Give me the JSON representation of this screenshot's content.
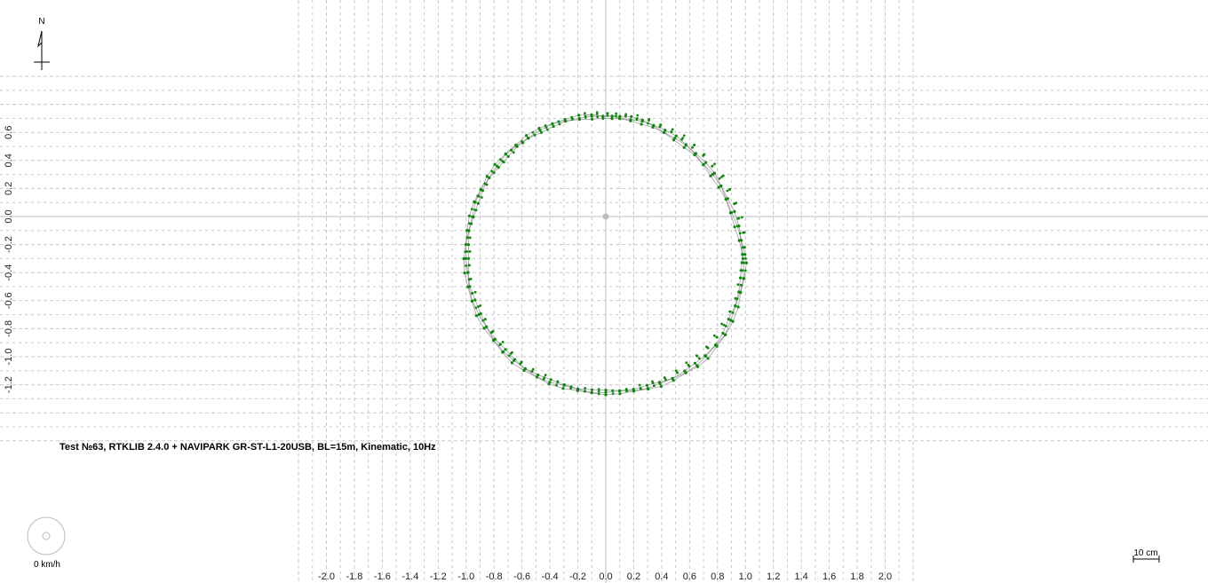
{
  "chart_data": {
    "type": "scatter",
    "title": "",
    "annotation": "Test №63, RTKLIB 2.4.0 + NAVIPARK GR-ST-L1-20USB, BL=15m, Kinematic, 10Hz",
    "xlabel": "",
    "ylabel": "",
    "xlim": [
      -2.0,
      2.0
    ],
    "ylim": [
      -1.2,
      0.6
    ],
    "x_ticks": [
      "-2.0",
      "-1.8",
      "-1.6",
      "-1.4",
      "-1.2",
      "-1.0",
      "-0.8",
      "-0.6",
      "-0.4",
      "-0.2",
      "0.0",
      "0.2",
      "0.4",
      "0.6",
      "0.8",
      "1.0",
      "1.2",
      "1.4",
      "1.6",
      "1.8",
      "2.0"
    ],
    "y_ticks": [
      "0.6",
      "0.4",
      "0.2",
      "0.0",
      "-0.2",
      "-0.4",
      "-0.6",
      "-0.8",
      "-1.0",
      "-1.2"
    ],
    "grid": true,
    "origin_marker": [
      0.0,
      0.0
    ],
    "series": [
      {
        "color": "#118811",
        "line_color": "#8f8f8f",
        "center": [
          0.0,
          -0.26
        ],
        "radius": 0.99,
        "laps": 3,
        "points": [
          [
            0.045,
            0.71
          ],
          [
            0.1,
            0.705
          ],
          [
            0.18,
            0.695
          ],
          [
            0.26,
            0.675
          ],
          [
            0.34,
            0.645
          ],
          [
            0.42,
            0.605
          ],
          [
            0.495,
            0.56
          ],
          [
            0.57,
            0.505
          ],
          [
            0.64,
            0.445
          ],
          [
            0.705,
            0.375
          ],
          [
            0.765,
            0.3
          ],
          [
            0.82,
            0.215
          ],
          [
            0.865,
            0.125
          ],
          [
            0.905,
            0.03
          ],
          [
            0.94,
            -0.07
          ],
          [
            0.965,
            -0.17
          ],
          [
            0.985,
            -0.27
          ],
          [
            0.99,
            -0.33
          ],
          [
            0.98,
            -0.44
          ],
          [
            0.96,
            -0.54
          ],
          [
            0.935,
            -0.64
          ],
          [
            0.895,
            -0.74
          ],
          [
            0.85,
            -0.84
          ],
          [
            0.79,
            -0.92
          ],
          [
            0.72,
            -1.0
          ],
          [
            0.65,
            -1.06
          ],
          [
            0.57,
            -1.11
          ],
          [
            0.48,
            -1.16
          ],
          [
            0.39,
            -1.195
          ],
          [
            0.3,
            -1.22
          ],
          [
            0.2,
            -1.24
          ],
          [
            0.1,
            -1.25
          ],
          [
            0.0,
            -1.255
          ],
          [
            -0.1,
            -1.25
          ],
          [
            -0.2,
            -1.235
          ],
          [
            -0.3,
            -1.21
          ],
          [
            -0.4,
            -1.18
          ],
          [
            -0.49,
            -1.14
          ],
          [
            -0.58,
            -1.09
          ],
          [
            -0.66,
            -1.03
          ],
          [
            -0.73,
            -0.96
          ],
          [
            -0.8,
            -0.88
          ],
          [
            -0.86,
            -0.79
          ],
          [
            -0.91,
            -0.7
          ],
          [
            -0.95,
            -0.6
          ],
          [
            -0.98,
            -0.5
          ],
          [
            -0.995,
            -0.4
          ],
          [
            -1.0,
            -0.3
          ],
          [
            -0.995,
            -0.2
          ],
          [
            -0.985,
            -0.1
          ],
          [
            -0.96,
            0.0
          ],
          [
            -0.93,
            0.1
          ],
          [
            -0.89,
            0.19
          ],
          [
            -0.84,
            0.28
          ],
          [
            -0.78,
            0.36
          ],
          [
            -0.71,
            0.44
          ],
          [
            -0.64,
            0.505
          ],
          [
            -0.56,
            0.565
          ],
          [
            -0.47,
            0.615
          ],
          [
            -0.38,
            0.655
          ],
          [
            -0.29,
            0.685
          ],
          [
            -0.19,
            0.705
          ],
          [
            -0.1,
            0.712
          ],
          [
            -0.02,
            0.71
          ]
        ]
      }
    ]
  },
  "compass": {
    "north_label": "N",
    "icon": "north-arrow-icon"
  },
  "speed_dial": {
    "label": "0 km/h",
    "icon": "speed-dial-icon"
  },
  "scale_bar": {
    "label": "10 cm"
  },
  "colors": {
    "background": "#ffffff",
    "grid": "#c8c8c8",
    "axis_zero": "#bdbdbd",
    "points": "#118811",
    "track": "#8f8f8f"
  }
}
